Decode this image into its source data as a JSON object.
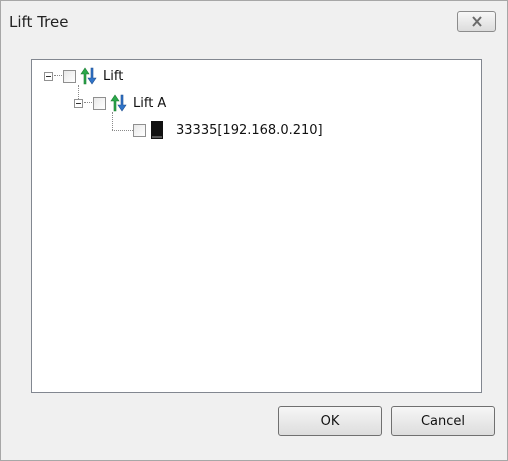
{
  "window": {
    "title": "Lift Tree",
    "close_icon": "close-icon"
  },
  "tree": {
    "root": {
      "label": "Lift",
      "icon": "lift-group-icon",
      "checked": false,
      "expanded": true,
      "children": [
        {
          "label": "Lift A",
          "icon": "lift-group-icon",
          "checked": false,
          "expanded": true,
          "children": [
            {
              "label": "33335[192.168.0.210]",
              "icon": "device-icon",
              "checked": false
            }
          ]
        }
      ]
    }
  },
  "buttons": {
    "ok_label": "OK",
    "cancel_label": "Cancel"
  },
  "colors": {
    "dialog_bg": "#f0f0f0",
    "panel_bg": "#ffffff",
    "icon_green": "#2aa84a",
    "icon_blue": "#2f74c9"
  }
}
